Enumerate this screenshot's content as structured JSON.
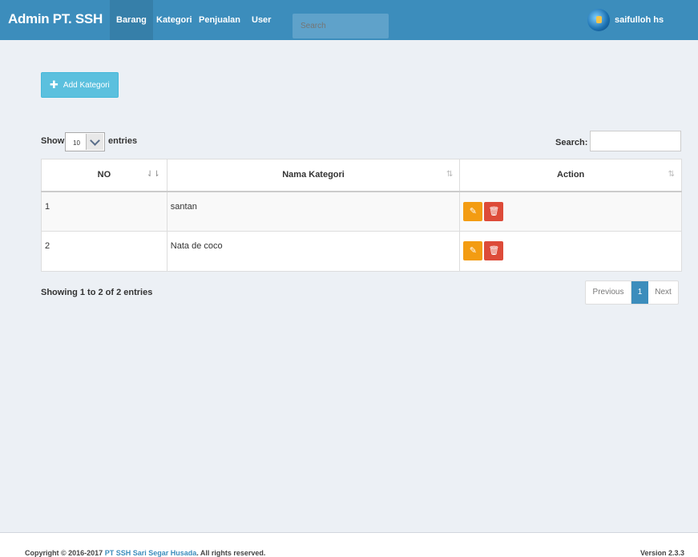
{
  "navbar": {
    "brand": "Admin PT. SSH",
    "items": [
      {
        "label": "Barang",
        "active": true
      },
      {
        "label": "Kategori",
        "active": false
      },
      {
        "label": "Penjualan",
        "active": false
      },
      {
        "label": "User",
        "active": false
      }
    ],
    "search_placeholder": "Search",
    "user_name": "saifulloh hs"
  },
  "toolbar": {
    "add_label": "Add Kategori"
  },
  "controls": {
    "show_label": "Show",
    "page_size": "10",
    "entries_label": "entries",
    "search_label": "Search:"
  },
  "table": {
    "headers": [
      "NO",
      "Nama Kategori",
      "Action"
    ],
    "rows": [
      {
        "no": "1",
        "name": "santan"
      },
      {
        "no": "2",
        "name": "Nata de coco"
      }
    ]
  },
  "info": "Showing 1 to 2 of 2 entries",
  "pagination": {
    "prev": "Previous",
    "current": "1",
    "next": "Next"
  },
  "footer": {
    "copyright_prefix": "Copyright © 2016-2017",
    "company": "PT SSH Sari Segar Husada",
    "copyright_suffix": ". All rights reserved.",
    "version": "Version 2.3.3"
  },
  "colors": {
    "header": "#3c8dbc",
    "add_button": "#5bc0de",
    "edit_button": "#f39c12",
    "delete_button": "#dd4b39"
  }
}
